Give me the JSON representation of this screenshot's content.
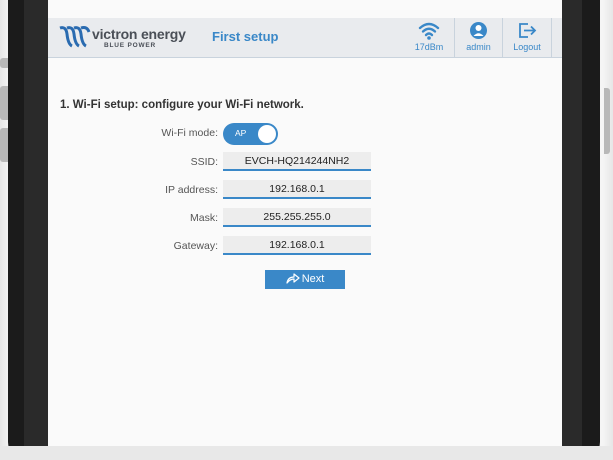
{
  "header": {
    "brand": "victron energy",
    "brand_sub": "BLUE POWER",
    "title": "First setup",
    "wifi": {
      "icon": "wifi-icon",
      "label": "17dBm"
    },
    "admin": {
      "icon": "user-icon",
      "label": "admin"
    },
    "logout": {
      "icon": "logout-icon",
      "label": "Logout"
    }
  },
  "wifi_setup": {
    "section_title": "1. Wi-Fi setup: configure your Wi-Fi network.",
    "mode_label": "Wi-Fi mode:",
    "mode_value": "AP",
    "ssid_label": "SSID:",
    "ssid_value": "EVCH-HQ214244NH2",
    "ip_label": "IP address:",
    "ip_value": "192.168.0.1",
    "mask_label": "Mask:",
    "mask_value": "255.255.255.0",
    "gateway_label": "Gateway:",
    "gateway_value": "192.168.0.1",
    "next_label": "Next"
  },
  "colors": {
    "accent": "#3a88c8",
    "header_bg": "#e9ebee",
    "field_bg": "#ededed",
    "frame": "#1b1b1b"
  }
}
